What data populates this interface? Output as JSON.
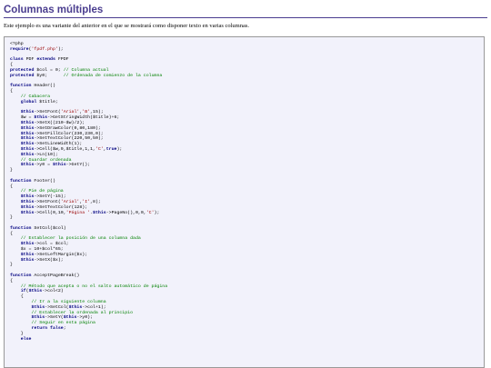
{
  "page": {
    "title": "Columnas múltiples",
    "intro": "Este ejemplo es una variante del anterior en el que se mostrará como disponer texto en varias columnas."
  },
  "code": {
    "language": "php",
    "lines": [
      "<?php",
      "require('fpdf.php');",
      "",
      "class PDF extends FPDF",
      "{",
      "protected $col = 0; // Columna actual",
      "protected $y0;      // Ordenada de comienzo de la columna",
      "",
      "function Header()",
      "{",
      "    // Cabacera",
      "    global $title;",
      "",
      "    $this->SetFont('Arial','B',15);",
      "    $w = $this->GetStringWidth($title)+6;",
      "    $this->SetX((210-$w)/2);",
      "    $this->SetDrawColor(0,80,180);",
      "    $this->SetFillColor(230,230,0);",
      "    $this->SetTextColor(220,50,50);",
      "    $this->SetLineWidth(1);",
      "    $this->Cell($w,9,$title,1,1,'C',true);",
      "    $this->Ln(10);",
      "    // Guardar ordenada",
      "    $this->y0 = $this->GetY();",
      "}",
      "",
      "function Footer()",
      "{",
      "    // Pie de página",
      "    $this->SetY(-15);",
      "    $this->SetFont('Arial','I',8);",
      "    $this->SetTextColor(128);",
      "    $this->Cell(0,10,'Página '.$this->PageNo(),0,0,'C');",
      "}",
      "",
      "function SetCol($col)",
      "{",
      "    // Establecer la posición de una columna dada",
      "    $this->col = $col;",
      "    $x = 10+$col*65;",
      "    $this->SetLeftMargin($x);",
      "    $this->SetX($x);",
      "}",
      "",
      "function AcceptPageBreak()",
      "{",
      "    // Método que acepta o no el salto automático de página",
      "    if($this->col<2)",
      "    {",
      "        // Ir a la siguiente columna",
      "        $this->SetCol($this->col+1);",
      "        // Establecer la ordenada al principio",
      "        $this->SetY($this->y0);",
      "        // Seguir en esta página",
      "        return false;",
      "    }",
      "    else"
    ]
  },
  "colors": {
    "heading": "#4a3d8f",
    "code_background": "#f2f2fb",
    "keyword": "#000080",
    "comment": "#008000",
    "string": "#990000"
  }
}
